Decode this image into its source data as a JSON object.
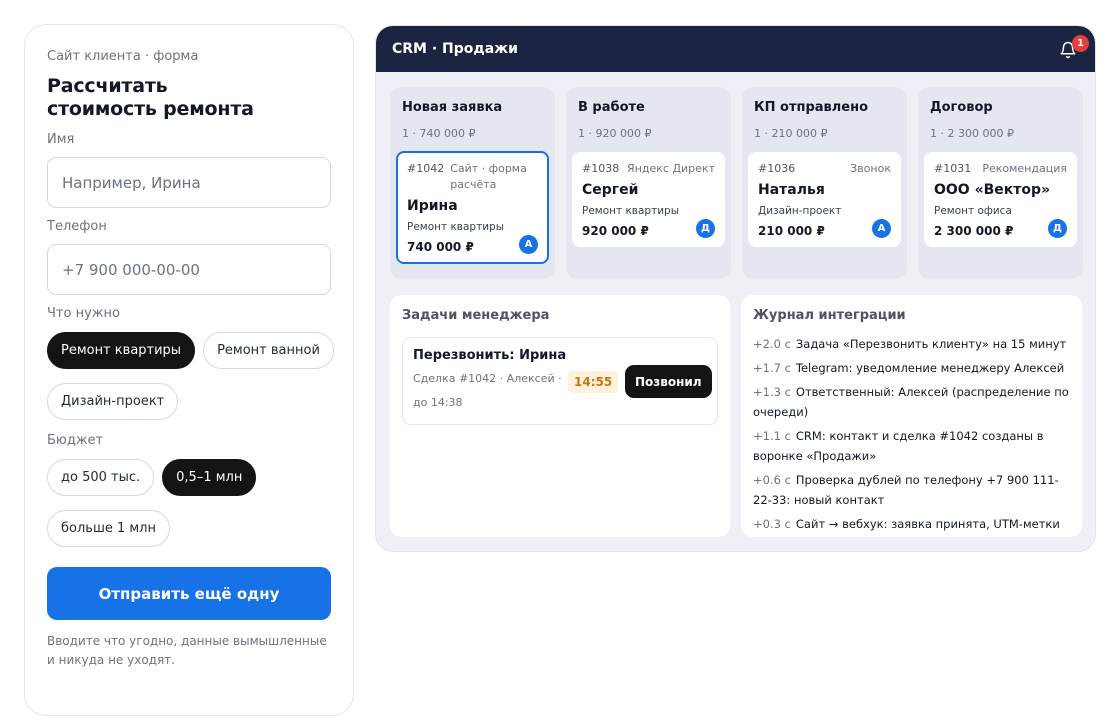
{
  "form": {
    "eyebrow": "Сайт клиента · форма",
    "title": "Рассчитать\nстоимость ремонта",
    "name_label": "Имя",
    "name_placeholder": "Например, Ирина",
    "phone_label": "Телефон",
    "phone_placeholder": "+7 900 000-00-00",
    "need_label": "Что нужно",
    "needs": [
      {
        "label": "Ремонт квартиры",
        "active": true
      },
      {
        "label": "Ремонт ванной",
        "active": false
      },
      {
        "label": "Дизайн-проект",
        "active": false
      }
    ],
    "budget_label": "Бюджет",
    "budgets": [
      {
        "label": "до 500 тыс.",
        "active": false
      },
      {
        "label": "0,5–1 млн",
        "active": true
      },
      {
        "label": "больше 1 млн",
        "active": false
      }
    ],
    "submit_label": "Отправить ещё одну",
    "note": "Вводите что угодно, данные вымышленные и никуда не уходят."
  },
  "crm": {
    "title": "CRM · Продажи",
    "notification_count": "1",
    "bell_icon": "bell-icon",
    "columns": [
      {
        "title": "Новая заявка",
        "meta": "1 · 740 000 ₽",
        "deals": [
          {
            "id": "#1042",
            "source": "Сайт · форма расчёта",
            "name": "Ирина",
            "desc": "Ремонт квартиры",
            "amount": "740 000 ₽",
            "avatar": "А",
            "selected": true
          }
        ]
      },
      {
        "title": "В работе",
        "meta": "1 · 920 000 ₽",
        "deals": [
          {
            "id": "#1038",
            "source": "Яндекс Директ",
            "name": "Сергей",
            "desc": "Ремонт квартиры",
            "amount": "920 000 ₽",
            "avatar": "Д",
            "selected": false
          }
        ]
      },
      {
        "title": "КП отправлено",
        "meta": "1 · 210 000 ₽",
        "deals": [
          {
            "id": "#1036",
            "source": "Звонок",
            "name": "Наталья",
            "desc": "Дизайн-проект",
            "amount": "210 000 ₽",
            "avatar": "А",
            "selected": false
          }
        ]
      },
      {
        "title": "Договор",
        "meta": "1 · 2 300 000 ₽",
        "deals": [
          {
            "id": "#1031",
            "source": "Рекомендация",
            "name": "ООО «Вектор»",
            "desc": "Ремонт офиса",
            "amount": "2 300 000 ₽",
            "avatar": "Д",
            "selected": false
          }
        ]
      }
    ],
    "tasks": {
      "title": "Задачи менеджера",
      "items": [
        {
          "title": "Перезвонить: Ирина",
          "meta": "Сделка #1042 · Алексей · до 14:38",
          "time": "14:55",
          "action": "Позвонил"
        }
      ]
    },
    "log": {
      "title": "Журнал интеграции",
      "entries": [
        {
          "time": "+2.0 с",
          "text": "Задача «Перезвонить клиенту» на 15 минут"
        },
        {
          "time": "+1.7 с",
          "text": "Telegram: уведомление менеджеру Алексей"
        },
        {
          "time": "+1.3 с",
          "text": "Ответственный: Алексей (распределение по очереди)"
        },
        {
          "time": "+1.1 с",
          "text": "CRM: контакт и сделка #1042 созданы в воронке «Продажи»"
        },
        {
          "time": "+0.6 с",
          "text": "Проверка дублей по телефону +7 900 111-22-33: новый контакт"
        },
        {
          "time": "+0.3 с",
          "text": "Сайт → вебхук: заявка принята, UTM-метки сохранены"
        }
      ]
    }
  }
}
